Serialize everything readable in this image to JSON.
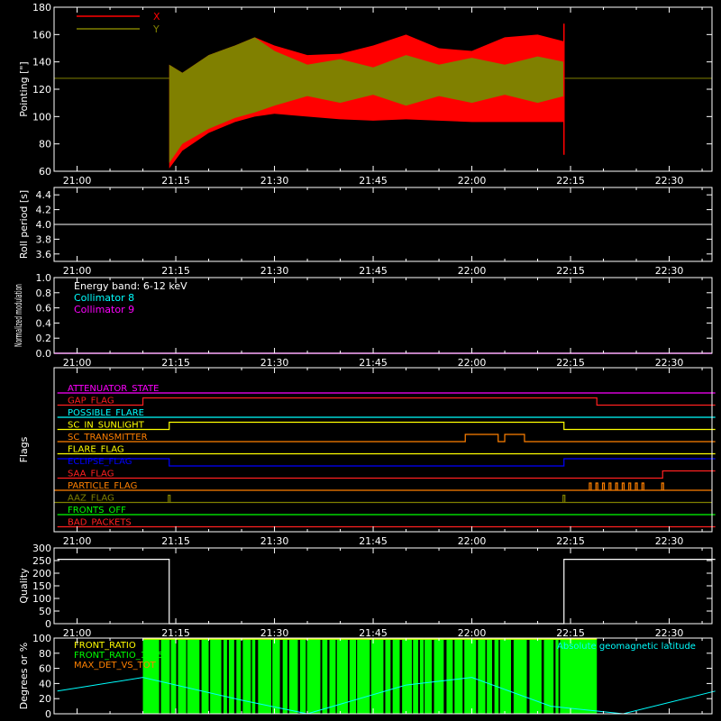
{
  "time_ticks": [
    "21:00",
    "21:15",
    "21:30",
    "21:45",
    "22:00",
    "22:15",
    "22:30"
  ],
  "chart_data": [
    {
      "type": "line",
      "ylabel": "Pointing [\"]",
      "ylim": [
        60,
        180
      ],
      "yticks": [
        60,
        80,
        100,
        120,
        140,
        160,
        180
      ],
      "legend": [
        {
          "name": "X",
          "color": "#ff0000"
        },
        {
          "name": "Y",
          "color": "#808000"
        }
      ],
      "x_range": [
        "21:14",
        "22:14"
      ],
      "constant_before_after": 128,
      "envelope_x": {
        "t": [
          "21:14",
          "21:16",
          "21:20",
          "21:24",
          "21:27",
          "21:30",
          "21:35",
          "21:40",
          "21:45",
          "21:50",
          "21:55",
          "22:00",
          "22:05",
          "22:10",
          "22:14"
        ],
        "upper": [
          138,
          132,
          145,
          152,
          158,
          152,
          145,
          146,
          152,
          160,
          150,
          148,
          158,
          160,
          155
        ],
        "lower": [
          62,
          75,
          88,
          96,
          100,
          102,
          100,
          98,
          97,
          98,
          97,
          96,
          96,
          96,
          96
        ]
      },
      "envelope_y": {
        "t": [
          "21:14",
          "21:16",
          "21:20",
          "21:24",
          "21:27",
          "21:30",
          "21:35",
          "21:40",
          "21:45",
          "21:50",
          "21:55",
          "22:00",
          "22:05",
          "22:10",
          "22:14"
        ],
        "upper": [
          138,
          132,
          145,
          152,
          158,
          148,
          138,
          142,
          136,
          145,
          138,
          143,
          138,
          144,
          140
        ],
        "lower": [
          66,
          80,
          91,
          99,
          103,
          108,
          115,
          110,
          116,
          108,
          115,
          110,
          116,
          110,
          115
        ]
      }
    },
    {
      "type": "line",
      "ylabel": "Roll period [s]",
      "ylim": [
        3.5,
        4.5
      ],
      "yticks": [
        3.6,
        3.8,
        4.0,
        4.2,
        4.4
      ],
      "constant": 4.0,
      "color": "#ffffff"
    },
    {
      "type": "line",
      "ylabel": "Normalized modulation",
      "ylim": [
        0.0,
        1.0
      ],
      "yticks": [
        0.0,
        0.2,
        0.4,
        0.6,
        0.8,
        1.0
      ],
      "annotations": [
        {
          "text": "Energy band: 6-12 keV",
          "color": "#ffffff"
        },
        {
          "text": "Collimator 8",
          "color": "#00ffff"
        },
        {
          "text": "Collimator 9",
          "color": "#ff00ff"
        }
      ],
      "constant": 0.0,
      "color": "#ff00ff"
    },
    {
      "type": "line",
      "ylabel": "Flags",
      "flags": [
        {
          "name": "ATTENUATOR_STATE",
          "color": "#ff00ff",
          "segments": [
            {
              "from": "20:57",
              "to": "22:37",
              "v": 0
            }
          ]
        },
        {
          "name": "GAP_FLAG",
          "color": "#ff2020",
          "segments": [
            {
              "from": "20:57",
              "to": "21:10",
              "v": 0
            },
            {
              "from": "21:10",
              "to": "22:19",
              "v": 1
            },
            {
              "from": "22:19",
              "to": "22:37",
              "v": 0
            }
          ]
        },
        {
          "name": "POSSIBLE_FLARE",
          "color": "#00ffff",
          "segments": [
            {
              "from": "20:57",
              "to": "22:37",
              "v": 0
            }
          ]
        },
        {
          "name": "SC_IN_SUNLIGHT",
          "color": "#ffff00",
          "segments": [
            {
              "from": "20:57",
              "to": "21:14",
              "v": 0
            },
            {
              "from": "21:14",
              "to": "22:14",
              "v": 1
            },
            {
              "from": "22:14",
              "to": "22:37",
              "v": 0
            }
          ]
        },
        {
          "name": "SC_TRANSMITTER",
          "color": "#ff8000",
          "segments": [
            {
              "from": "20:57",
              "to": "21:59",
              "v": 0
            },
            {
              "from": "21:59",
              "to": "22:04",
              "v": 1
            },
            {
              "from": "22:04",
              "to": "22:05",
              "v": 0
            },
            {
              "from": "22:05",
              "to": "22:08",
              "v": 1
            },
            {
              "from": "22:08",
              "to": "22:37",
              "v": 0
            }
          ]
        },
        {
          "name": "FLARE_FLAG",
          "color": "#ffff00",
          "segments": [
            {
              "from": "20:57",
              "to": "22:37",
              "v": 0
            }
          ]
        },
        {
          "name": "ECLIPSE_FLAG",
          "color": "#0000ff",
          "segments": [
            {
              "from": "20:57",
              "to": "21:14",
              "v": 1
            },
            {
              "from": "21:14",
              "to": "22:14",
              "v": 0
            },
            {
              "from": "22:14",
              "to": "22:37",
              "v": 1
            }
          ]
        },
        {
          "name": "SAA_FLAG",
          "color": "#ff2020",
          "segments": [
            {
              "from": "20:57",
              "to": "22:29",
              "v": 0
            },
            {
              "from": "22:29",
              "to": "22:37",
              "v": 1
            }
          ]
        },
        {
          "name": "PARTICLE_FLAG",
          "color": "#ff8000",
          "spikes": [
            "22:18",
            "22:19",
            "22:20",
            "22:21",
            "22:22",
            "22:23",
            "22:24",
            "22:25",
            "22:26",
            "22:29"
          ]
        },
        {
          "name": "AAZ_FLAG",
          "color": "#808000",
          "spikes": [
            "21:14",
            "22:14"
          ]
        },
        {
          "name": "FRONTS_OFF",
          "color": "#00ff00",
          "segments": [
            {
              "from": "20:57",
              "to": "22:37",
              "v": 0
            }
          ]
        },
        {
          "name": "BAD_PACKETS",
          "color": "#ff2020",
          "segments": [
            {
              "from": "20:57",
              "to": "22:37",
              "v": 0
            }
          ]
        }
      ]
    },
    {
      "type": "line",
      "ylabel": "Quality",
      "ylim": [
        0,
        300
      ],
      "yticks": [
        0,
        50,
        100,
        150,
        200,
        250,
        300
      ],
      "segments": [
        {
          "from": "20:57",
          "to": "21:14",
          "v": 255
        },
        {
          "from": "21:14",
          "to": "22:14",
          "v": 0
        },
        {
          "from": "22:14",
          "to": "22:37",
          "v": 255
        }
      ],
      "color": "#ffffff"
    },
    {
      "type": "line",
      "ylabel": "Degrees or %",
      "ylim": [
        0,
        100
      ],
      "yticks": [
        0,
        20,
        40,
        60,
        80,
        100
      ],
      "legend": [
        {
          "name": "FRONT_RATIO",
          "color": "#ffff00"
        },
        {
          "name": "FRONT_RATIO_1225",
          "color": "#00ff00"
        },
        {
          "name": "MAX_DET_VS_TOT",
          "color": "#ff8000"
        }
      ],
      "annotation": {
        "text": "Absolute geomagnetic latitude",
        "color": "#00ffff"
      },
      "latitude": {
        "t": [
          "20:57",
          "21:10",
          "21:25",
          "21:35",
          "21:50",
          "22:00",
          "22:12",
          "22:23",
          "22:37"
        ],
        "v": [
          30,
          48,
          18,
          0,
          38,
          48,
          10,
          0,
          30
        ]
      },
      "front_ratio_1225_range": [
        "21:10",
        "22:19"
      ],
      "colors": {
        "latitude": "#00ffff",
        "front_ratio_1225": "#00ff00",
        "front_ratio": "#ffff00"
      }
    }
  ]
}
